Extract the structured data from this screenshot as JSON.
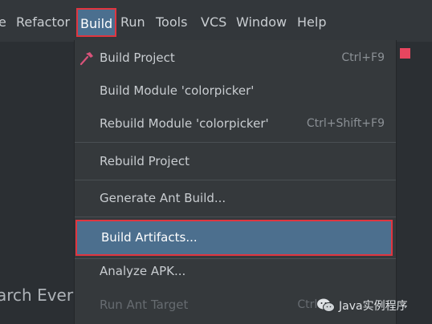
{
  "menubar": {
    "items": [
      {
        "label": "e"
      },
      {
        "label": "Refactor"
      },
      {
        "label": "Build"
      },
      {
        "label": "Run"
      },
      {
        "label": "Tools"
      },
      {
        "label": "VCS"
      },
      {
        "label": "Window"
      },
      {
        "label": "Help"
      }
    ]
  },
  "build_menu": {
    "items": [
      {
        "label": "Build Project",
        "shortcut": "Ctrl+F9",
        "icon": "hammer-icon"
      },
      {
        "label": "Build Module 'colorpicker'",
        "shortcut": ""
      },
      {
        "label": "Rebuild Module 'colorpicker'",
        "shortcut": "Ctrl+Shift+F9"
      },
      {
        "label": "Rebuild Project",
        "shortcut": ""
      },
      {
        "label": "Generate Ant Build...",
        "shortcut": ""
      },
      {
        "label": "Build Artifacts...",
        "shortcut": ""
      },
      {
        "label": "Analyze APK...",
        "shortcut": ""
      },
      {
        "label": "Run Ant Target",
        "shortcut": "Ctrl+"
      }
    ]
  },
  "background": {
    "side_text": "arch Every"
  },
  "watermark": {
    "text": "Java实例程序",
    "icon": "wechat-icon"
  },
  "colors": {
    "menubar_bg": "#33373b",
    "menu_bg": "#35393c",
    "selection": "#4c6f8e",
    "highlight_border": "#e0353f",
    "accent_square": "#e8465f",
    "hammer": "#d9537a"
  }
}
